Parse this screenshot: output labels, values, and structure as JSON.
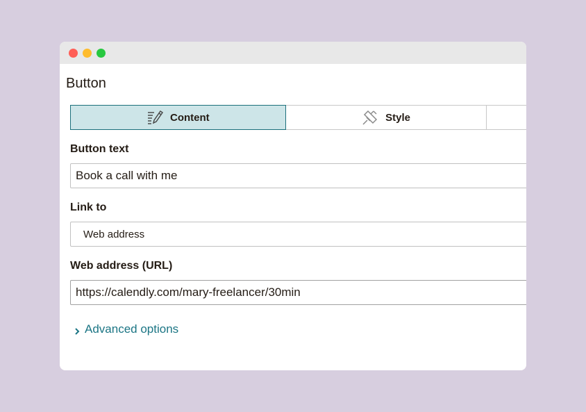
{
  "panel": {
    "title": "Button"
  },
  "tabs": [
    {
      "label": "Content",
      "icon": "pencil-edit-icon",
      "active": true
    },
    {
      "label": "Style",
      "icon": "paint-brush-icon",
      "active": false
    },
    {
      "label": "",
      "icon": "",
      "active": false
    }
  ],
  "fields": {
    "button_text": {
      "label": "Button text",
      "value": "Book a call with me"
    },
    "link_to": {
      "label": "Link to",
      "value": "Web address"
    },
    "url": {
      "label": "Web address (URL)",
      "value": "https://calendly.com/mary-freelancer/30min"
    }
  },
  "advanced": {
    "label": "Advanced options",
    "icon": "chevron-right-icon"
  },
  "colors": {
    "accent": "#1b7584",
    "active_tab_bg": "#cde5e8",
    "background": "#d7cedf"
  }
}
